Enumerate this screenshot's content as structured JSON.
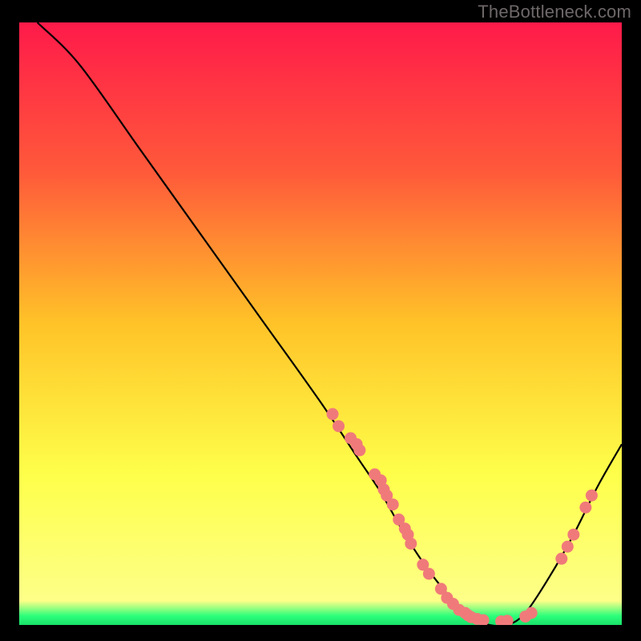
{
  "attribution": "TheBottleneck.com",
  "chart_data": {
    "type": "line",
    "title": "",
    "xlabel": "",
    "ylabel": "",
    "xlim": [
      0,
      100
    ],
    "ylim": [
      0,
      100
    ],
    "grid": false,
    "legend": false,
    "gradient_stops": [
      {
        "offset": 0.0,
        "color": "#ff1a4a"
      },
      {
        "offset": 0.25,
        "color": "#ff5a3a"
      },
      {
        "offset": 0.5,
        "color": "#ffc328"
      },
      {
        "offset": 0.75,
        "color": "#feff4a"
      },
      {
        "offset": 0.96,
        "color": "#fdff88"
      },
      {
        "offset": 0.985,
        "color": "#2cff7a"
      },
      {
        "offset": 1.0,
        "color": "#18e06a"
      }
    ],
    "series": [
      {
        "name": "bottleneck-curve",
        "type": "line",
        "color": "#000000",
        "x": [
          3,
          10,
          20,
          30,
          40,
          50,
          56,
          60,
          64,
          68,
          72,
          74,
          76,
          78,
          81,
          84,
          88,
          92,
          96,
          100
        ],
        "y": [
          100,
          93,
          79,
          65,
          51,
          37,
          28,
          22,
          15,
          9,
          4,
          2,
          1,
          0,
          0,
          2,
          8,
          15,
          23,
          30
        ]
      },
      {
        "name": "curve-markers",
        "type": "scatter",
        "color": "#f07a7a",
        "points": [
          {
            "x": 52,
            "y": 35
          },
          {
            "x": 53,
            "y": 33
          },
          {
            "x": 55,
            "y": 31
          },
          {
            "x": 56,
            "y": 30
          },
          {
            "x": 56.5,
            "y": 29
          },
          {
            "x": 59,
            "y": 25
          },
          {
            "x": 60,
            "y": 24
          },
          {
            "x": 60.5,
            "y": 22.5
          },
          {
            "x": 61,
            "y": 21.5
          },
          {
            "x": 62,
            "y": 20
          },
          {
            "x": 63,
            "y": 17.5
          },
          {
            "x": 64,
            "y": 16
          },
          {
            "x": 64.5,
            "y": 15
          },
          {
            "x": 65,
            "y": 13.5
          },
          {
            "x": 67,
            "y": 10
          },
          {
            "x": 68,
            "y": 8.5
          },
          {
            "x": 70,
            "y": 6
          },
          {
            "x": 71,
            "y": 4.5
          },
          {
            "x": 72,
            "y": 3.5
          },
          {
            "x": 73,
            "y": 2.5
          },
          {
            "x": 74,
            "y": 2
          },
          {
            "x": 74.5,
            "y": 1.6
          },
          {
            "x": 75,
            "y": 1.3
          },
          {
            "x": 76,
            "y": 1
          },
          {
            "x": 77,
            "y": 0.8
          },
          {
            "x": 80,
            "y": 0.6
          },
          {
            "x": 81,
            "y": 0.7
          },
          {
            "x": 84,
            "y": 1.4
          },
          {
            "x": 85,
            "y": 2
          },
          {
            "x": 90,
            "y": 11
          },
          {
            "x": 91,
            "y": 13
          },
          {
            "x": 92,
            "y": 15
          },
          {
            "x": 94,
            "y": 19.5
          },
          {
            "x": 95,
            "y": 21.5
          }
        ]
      }
    ]
  }
}
